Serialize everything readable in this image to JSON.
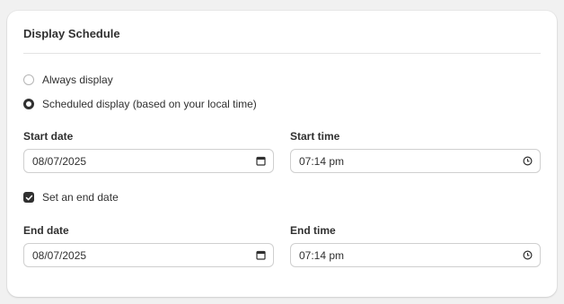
{
  "card": {
    "title": "Display Schedule"
  },
  "visibility": {
    "options": [
      {
        "label": "Always display",
        "selected": false
      },
      {
        "label": "Scheduled display (based on your local time)",
        "selected": true
      }
    ]
  },
  "start": {
    "date_label": "Start date",
    "date_value": "08/07/2025",
    "time_label": "Start time",
    "time_value": "07:14 pm"
  },
  "end_toggle": {
    "label": "Set an end date",
    "checked": true
  },
  "end": {
    "date_label": "End date",
    "date_value": "08/07/2025",
    "time_label": "End time",
    "time_value": "07:14 pm"
  },
  "icons": {
    "date_picker": "calendar-icon",
    "time_picker": "clock-icon",
    "checkbox_mark": "checkmark-icon"
  },
  "colors": {
    "text": "#303030",
    "border": "#cfcfcf",
    "background": "#f1f1f1",
    "card": "#ffffff"
  }
}
